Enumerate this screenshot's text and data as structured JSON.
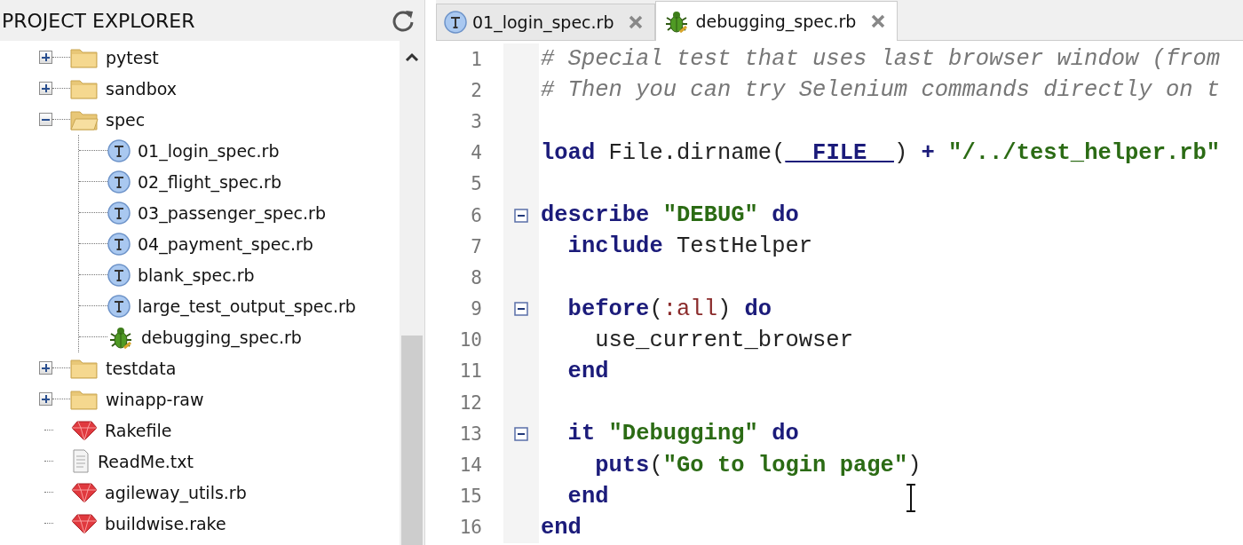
{
  "explorer": {
    "title": "PROJECT EXPLORER",
    "tree": [
      {
        "label": "pytest",
        "kind": "folder",
        "expanded": false
      },
      {
        "label": "sandbox",
        "kind": "folder",
        "expanded": false
      },
      {
        "label": "spec",
        "kind": "folder",
        "expanded": true,
        "children": [
          {
            "label": "01_login_spec.rb",
            "kind": "test"
          },
          {
            "label": "02_flight_spec.rb",
            "kind": "test"
          },
          {
            "label": "03_passenger_spec.rb",
            "kind": "test"
          },
          {
            "label": "04_payment_spec.rb",
            "kind": "test"
          },
          {
            "label": "blank_spec.rb",
            "kind": "test"
          },
          {
            "label": "large_test_output_spec.rb",
            "kind": "test"
          },
          {
            "label": "debugging_spec.rb",
            "kind": "debug"
          }
        ]
      },
      {
        "label": "testdata",
        "kind": "folder",
        "expanded": false
      },
      {
        "label": "winapp-raw",
        "kind": "folder",
        "expanded": false
      },
      {
        "label": "Rakefile",
        "kind": "ruby"
      },
      {
        "label": "ReadMe.txt",
        "kind": "text"
      },
      {
        "label": "agileway_utils.rb",
        "kind": "ruby"
      },
      {
        "label": "buildwise.rake",
        "kind": "ruby"
      }
    ]
  },
  "tabs": [
    {
      "label": "01_login_spec.rb",
      "kind": "test",
      "selected": false
    },
    {
      "label": "debugging_spec.rb",
      "kind": "debug",
      "selected": true
    }
  ],
  "editor": {
    "lines": [
      {
        "number": "1",
        "fold": false,
        "tokens": [
          {
            "kind": "comment",
            "text": "# Special test that uses last browser window (from"
          }
        ]
      },
      {
        "number": "2",
        "fold": false,
        "tokens": [
          {
            "kind": "comment",
            "text": "# Then you can try Selenium commands directly on t"
          }
        ]
      },
      {
        "number": "3",
        "fold": false
      },
      {
        "number": "4",
        "fold": false,
        "tokens": [
          {
            "kind": "keyword",
            "text": "load"
          },
          {
            "kind": "plain",
            "text": " File.dirname("
          },
          {
            "kind": "constant",
            "text": "__FILE__"
          },
          {
            "kind": "plain",
            "text": ") "
          },
          {
            "kind": "keyword",
            "text": "+"
          },
          {
            "kind": "string",
            "text": " \"/../test_helper.rb\""
          }
        ]
      },
      {
        "number": "5",
        "fold": false
      },
      {
        "number": "6",
        "fold": true,
        "tokens": [
          {
            "kind": "keyword",
            "text": "describe"
          },
          {
            "kind": "string",
            "text": " \"DEBUG\""
          },
          {
            "kind": "keyword",
            "text": " do"
          }
        ]
      },
      {
        "number": "7",
        "fold": false,
        "tokens": [
          {
            "kind": "keyword",
            "text": "  include"
          },
          {
            "kind": "plain",
            "text": " TestHelper"
          }
        ]
      },
      {
        "number": "8",
        "fold": false
      },
      {
        "number": "9",
        "fold": true,
        "tokens": [
          {
            "kind": "keyword",
            "text": "  before"
          },
          {
            "kind": "plain",
            "text": "("
          },
          {
            "kind": "symbol",
            "text": ":all"
          },
          {
            "kind": "plain",
            "text": ") "
          },
          {
            "kind": "keyword",
            "text": "do"
          }
        ]
      },
      {
        "number": "10",
        "fold": false,
        "tokens": [
          {
            "kind": "plain",
            "text": "    use_current_browser"
          }
        ]
      },
      {
        "number": "11",
        "fold": false,
        "tokens": [
          {
            "kind": "keyword",
            "text": "  end"
          }
        ]
      },
      {
        "number": "12",
        "fold": false
      },
      {
        "number": "13",
        "fold": true,
        "tokens": [
          {
            "kind": "keyword",
            "text": "  it"
          },
          {
            "kind": "string",
            "text": " \"Debugging\""
          },
          {
            "kind": "keyword",
            "text": " do"
          }
        ]
      },
      {
        "number": "14",
        "fold": false,
        "tokens": [
          {
            "kind": "keyword",
            "text": "    puts"
          },
          {
            "kind": "plain",
            "text": "("
          },
          {
            "kind": "string",
            "text": "\"Go to login page\""
          },
          {
            "kind": "plain",
            "text": ")"
          }
        ]
      },
      {
        "number": "15",
        "fold": false,
        "tokens": [
          {
            "kind": "keyword",
            "text": "  end"
          }
        ]
      },
      {
        "number": "16",
        "fold": false,
        "tokens": [
          {
            "kind": "keyword",
            "text": "end"
          }
        ]
      }
    ]
  }
}
